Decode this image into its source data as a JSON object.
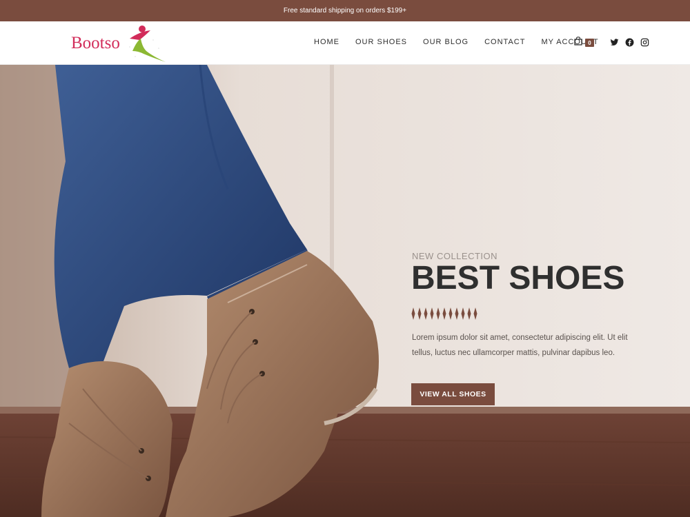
{
  "topbar": {
    "shipping_notice": "Free standard shipping on orders $199+"
  },
  "brand": {
    "logo_text": "Bootso",
    "logo_color": "#d22c5a",
    "accent_color": "#7a4c3e"
  },
  "nav": {
    "items": [
      {
        "label": "HOME"
      },
      {
        "label": "OUR SHOES"
      },
      {
        "label": "OUR BLOG"
      },
      {
        "label": "CONTACT"
      },
      {
        "label": "MY ACCOUNT"
      }
    ],
    "cart": {
      "icon": "shopping-bag-icon",
      "count": "0"
    },
    "social": [
      "twitter-icon",
      "facebook-icon",
      "instagram-icon"
    ]
  },
  "hero": {
    "eyebrow": "NEW COLLECTION",
    "headline": "BEST SHOES",
    "body": "Lorem ipsum dolor sit amet, consectetur adipiscing elit. Ut elit tellus, luctus nec ullamcorper mattis, pulvinar dapibus leo.",
    "cta_label": "VIEW ALL SHOES"
  }
}
